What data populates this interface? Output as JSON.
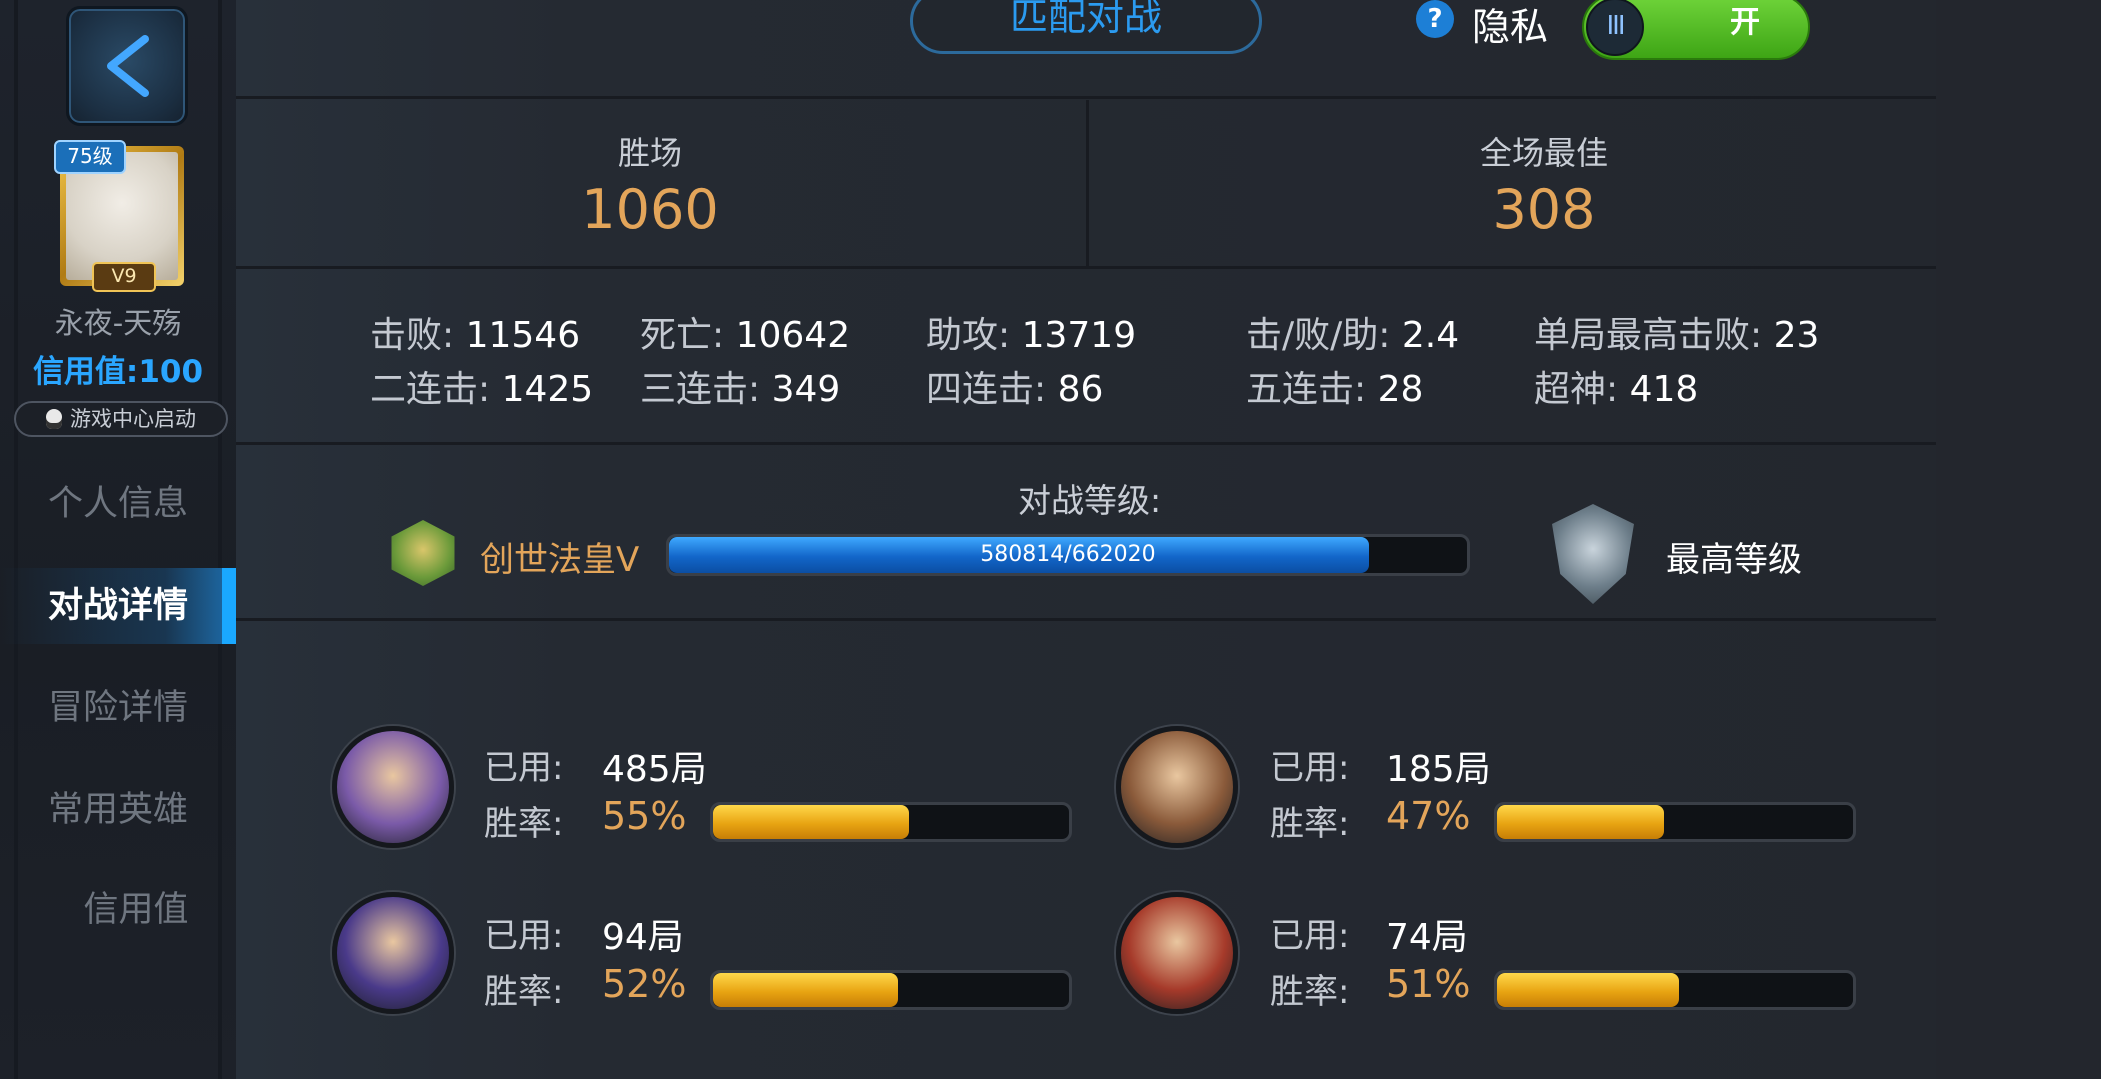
{
  "sidebar": {
    "level": "75级",
    "vip": "V9",
    "player_name": "永夜-天殇",
    "credit": "信用值:100",
    "game_center": "游戏中心启动",
    "nav": [
      {
        "label": "个人信息"
      },
      {
        "label": "对战详情"
      },
      {
        "label": "冒险详情"
      },
      {
        "label": "常用英雄"
      },
      {
        "label": "信用值"
      }
    ],
    "active_nav": "对战详情"
  },
  "header": {
    "mode": "匹配对战",
    "help": "?",
    "privacy_label": "隐私",
    "toggle_knob": "III",
    "toggle_state": "开"
  },
  "summary": {
    "wins_label": "胜场",
    "wins_value": "1060",
    "mvp_label": "全场最佳",
    "mvp_value": "308"
  },
  "stats": [
    {
      "label": "击败: ",
      "value": "11546"
    },
    {
      "label": "死亡: ",
      "value": "10642"
    },
    {
      "label": "助攻: ",
      "value": "13719"
    },
    {
      "label": "击/败/助: ",
      "value": "2.4"
    },
    {
      "label": "单局最高击败: ",
      "value": "23"
    },
    {
      "label": "二连击: ",
      "value": "1425"
    },
    {
      "label": "三连击: ",
      "value": "349"
    },
    {
      "label": "四连击: ",
      "value": "86"
    },
    {
      "label": "五连击: ",
      "value": "28"
    },
    {
      "label": "超神:  ",
      "value": "418"
    }
  ],
  "rank": {
    "title": "对战等级:",
    "name": "创世法皇Ⅴ",
    "progress_text": "580814/662020",
    "progress_fraction": 0.877,
    "max_label": "最高等级"
  },
  "heroes": [
    {
      "used_label": "已用:",
      "used": "485局",
      "rate_label": "胜率:",
      "rate": "55%",
      "rate_fraction": 0.55,
      "color": "#7a5aa8"
    },
    {
      "used_label": "已用:",
      "used": "185局",
      "rate_label": "胜率:",
      "rate": "47%",
      "rate_fraction": 0.47,
      "color": "#8a5a3a"
    },
    {
      "used_label": "已用:",
      "used": "94局",
      "rate_label": "胜率:",
      "rate": "52%",
      "rate_fraction": 0.52,
      "color": "#4a3a8a"
    },
    {
      "used_label": "已用:",
      "used": "74局",
      "rate_label": "胜率:",
      "rate": "51%",
      "rate_fraction": 0.51,
      "color": "#a63a2a"
    }
  ],
  "colors": {
    "accent_blue": "#2aa6ff",
    "gold_text": "#e3a55a",
    "toggle_green": "#4fbf22"
  }
}
